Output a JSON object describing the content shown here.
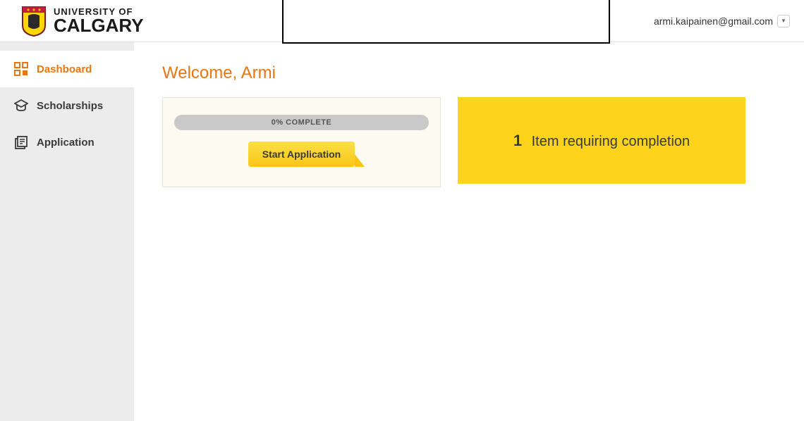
{
  "header": {
    "university_top": "UNIVERSITY OF",
    "university_bottom": "CALGARY",
    "user_email": "armi.kaipainen@gmail.com"
  },
  "sidebar": {
    "items": [
      {
        "label": "Dashboard",
        "icon": "dashboard-icon",
        "active": true
      },
      {
        "label": "Scholarships",
        "icon": "scholarship-icon",
        "active": false
      },
      {
        "label": "Application",
        "icon": "application-icon",
        "active": false
      }
    ]
  },
  "main": {
    "welcome_title": "Welcome, Armi",
    "progress_label": "0% COMPLETE",
    "start_button_label": "Start Application",
    "completion_count": "1",
    "completion_text": "Item requiring completion"
  }
}
